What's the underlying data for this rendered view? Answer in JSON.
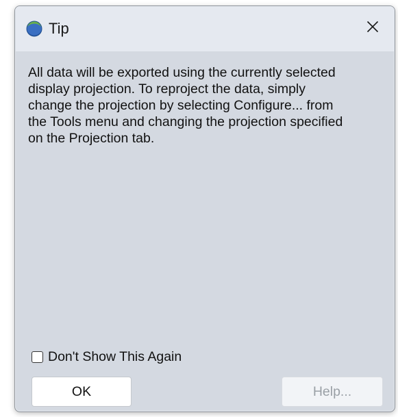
{
  "window": {
    "title": "Tip",
    "app_icon": "globe-app-icon",
    "close_icon": "close-icon"
  },
  "message": {
    "text": "All data will be exported using the currently selected\ndisplay projection. To reproject the data, simply\nchange the projection by selecting Configure... from\nthe Tools menu and changing the projection specified\non the Projection tab."
  },
  "checkbox": {
    "label": "Don't Show This Again",
    "checked": false
  },
  "buttons": {
    "ok_label": "OK",
    "help_label": "Help...",
    "help_enabled": false
  },
  "colors": {
    "dialog_bg": "#d4d9e1",
    "titlebar_bg": "#e5e9f0",
    "icon_green": "#2e8b3a",
    "icon_blue": "#2a5aa8"
  }
}
